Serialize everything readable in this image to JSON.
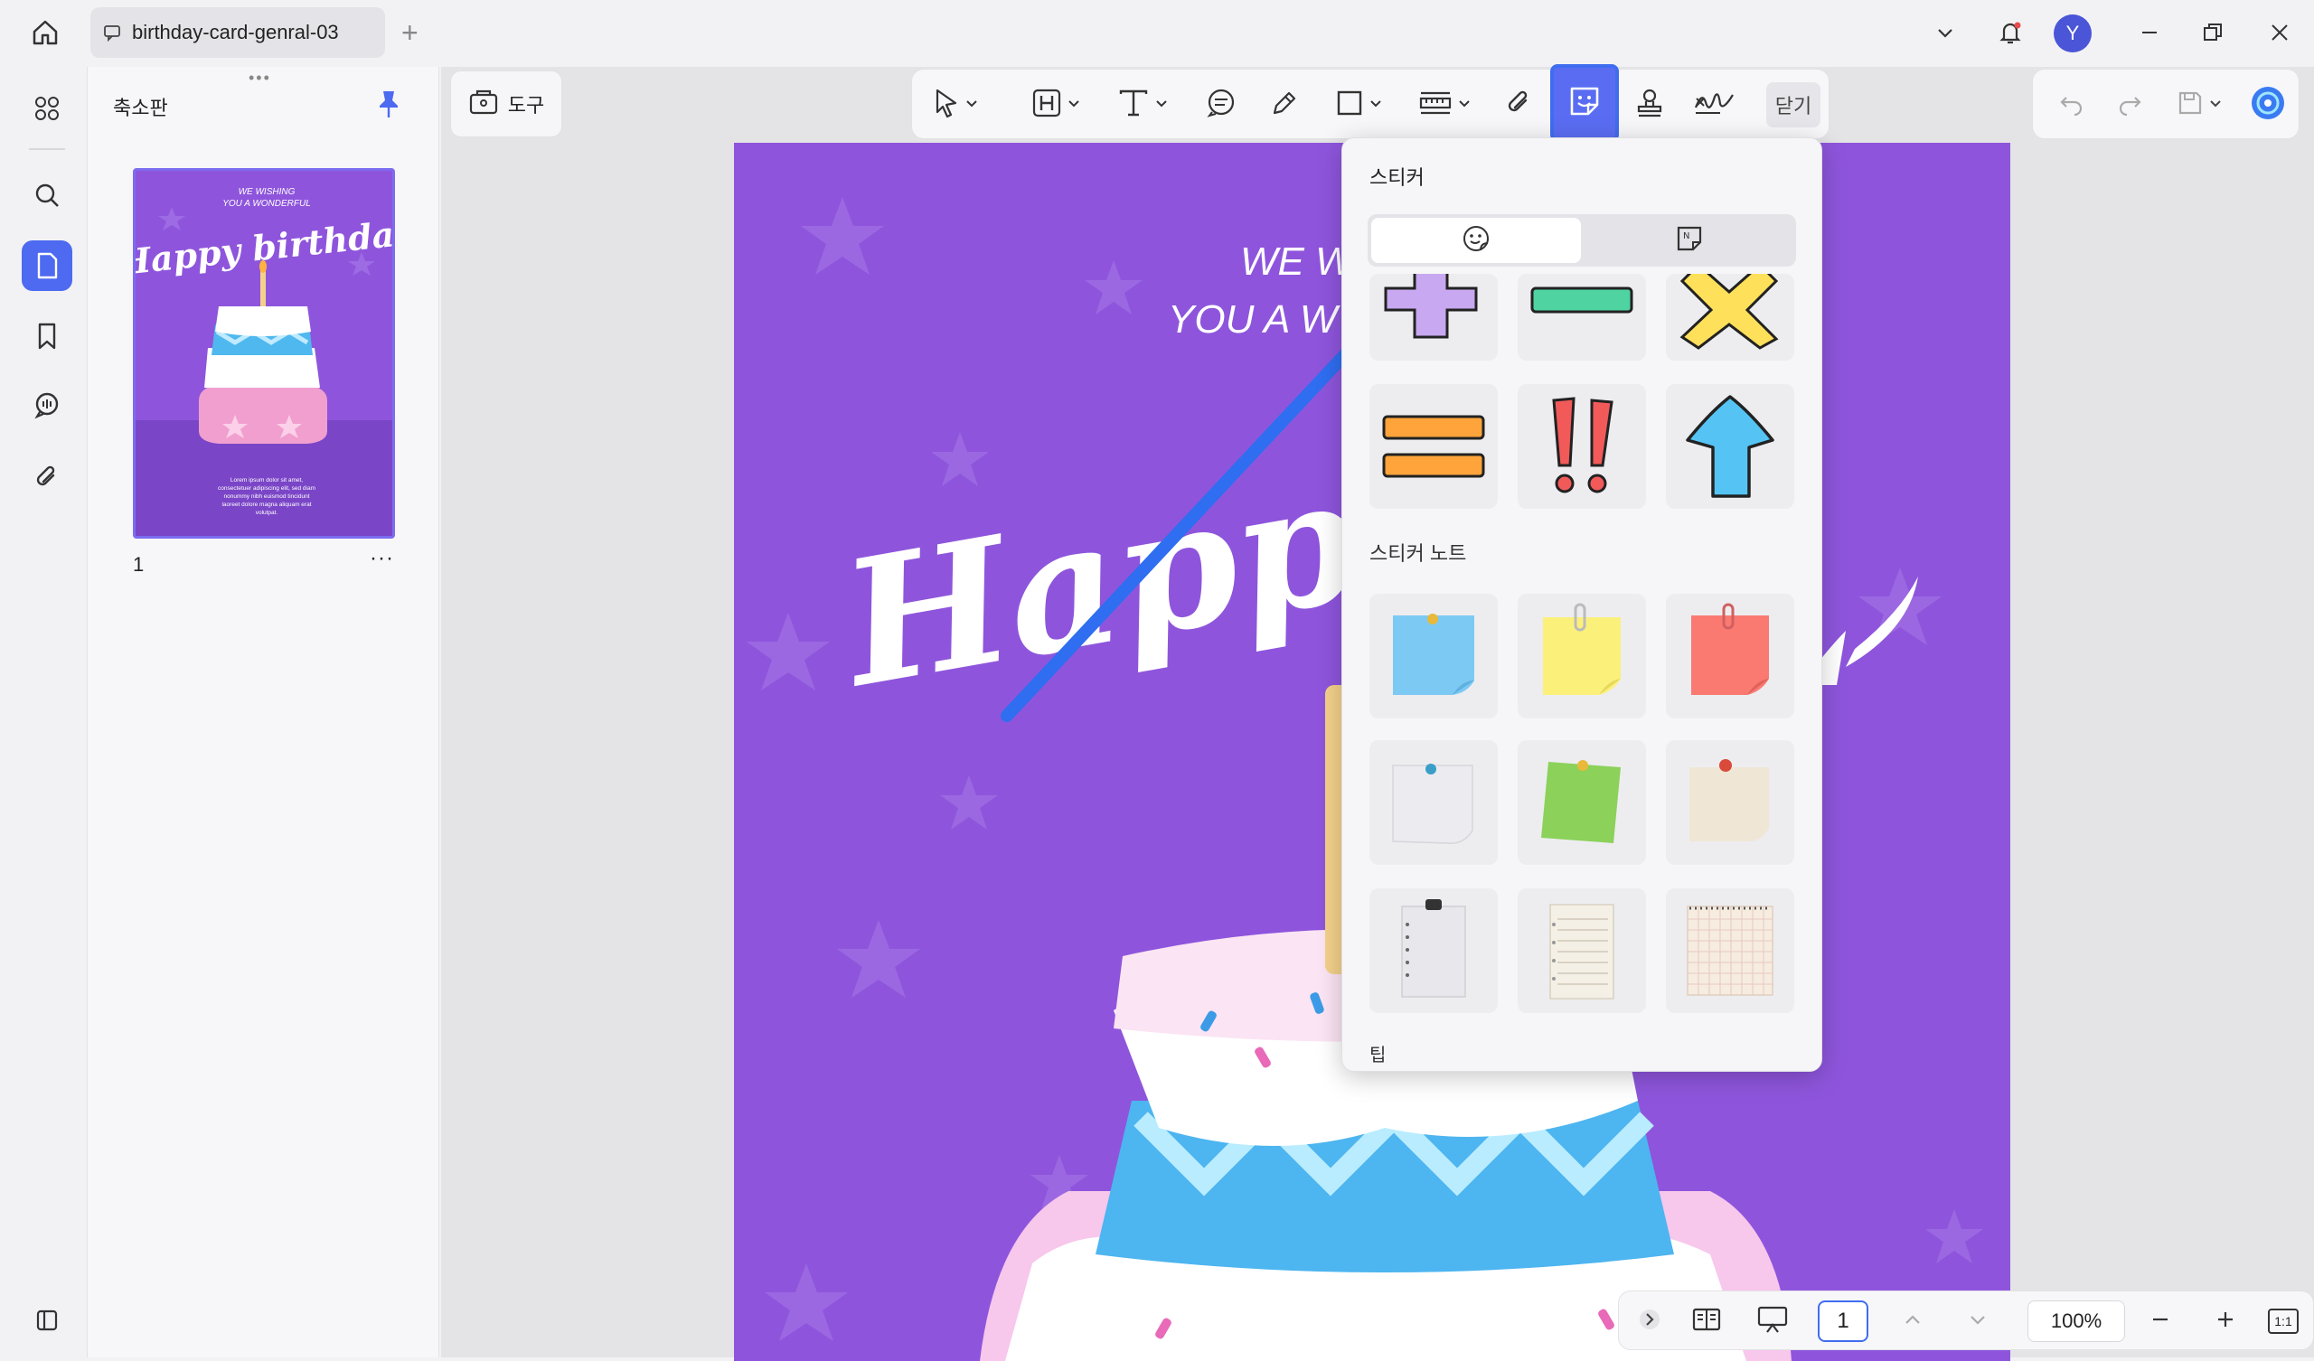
{
  "window": {
    "tab_title": "birthday-card-genral-03",
    "avatar_letter": "Y"
  },
  "sidebar": {
    "panel_title": "축소판",
    "page_number": "1",
    "more": "···"
  },
  "toolbar": {
    "tools_label": "도구",
    "close_label": "닫기"
  },
  "document": {
    "line1": "WE W",
    "line2": "YOU A W",
    "headline": "Happy",
    "thumb_line1": "WE WISHING",
    "thumb_line2": "YOU A WONDERFUL",
    "thumb_headline": "Happy birthday",
    "thumb_body": "Lorem ipsum dolor sit amet, consectetur adipiscing elit, sed diam nonummy nibh euismod tincidunt laoreet dolore magna aliquam erat volutpat."
  },
  "sticker_panel": {
    "title": "스티커",
    "section_notes": "스티커 노트",
    "tip": "팁"
  },
  "bottom": {
    "page_value": "1",
    "zoom": "100%",
    "fit": "1:1"
  },
  "colors": {
    "accent": "#4d6af0",
    "page_purple": "#8e55dc",
    "arrow_blue": "#2f6ef0"
  }
}
